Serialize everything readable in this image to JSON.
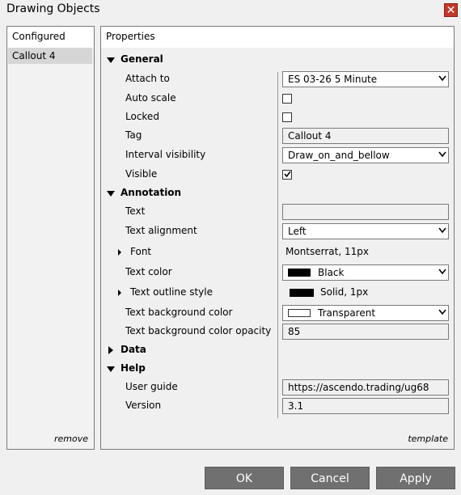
{
  "window": {
    "title": "Drawing Objects",
    "close_label": "✕"
  },
  "left_panel": {
    "header": "Configured",
    "items": [
      {
        "label": "Callout 4"
      }
    ],
    "remove_label": "remove"
  },
  "right_panel": {
    "header": "Properties",
    "template_label": "template",
    "general": {
      "label": "General",
      "attach_to": {
        "label": "Attach to",
        "value": "ES 03-26 5 Minute"
      },
      "auto_scale": {
        "label": "Auto scale",
        "checked": false
      },
      "locked": {
        "label": "Locked",
        "checked": false
      },
      "tag": {
        "label": "Tag",
        "value": "Callout 4"
      },
      "interval_visibility": {
        "label": "Interval visibility",
        "value": "Draw_on_and_bellow"
      },
      "visible": {
        "label": "Visible",
        "checked": true
      }
    },
    "annotation": {
      "label": "Annotation",
      "text": {
        "label": "Text",
        "value": ""
      },
      "text_alignment": {
        "label": "Text alignment",
        "value": "Left"
      },
      "font": {
        "label": "Font",
        "value": "Montserrat, 11px"
      },
      "text_color": {
        "label": "Text color",
        "value": "Black",
        "swatch": "#000000"
      },
      "text_outline_style": {
        "label": "Text outline style",
        "value": "Solid, 1px",
        "swatch": "#000000"
      },
      "text_background_color": {
        "label": "Text background color",
        "value": "Transparent",
        "swatch": "#ffffff"
      },
      "text_background_color_opacity": {
        "label": "Text background color opacity",
        "value": "85"
      }
    },
    "data": {
      "label": "Data"
    },
    "help": {
      "label": "Help",
      "user_guide": {
        "label": "User guide",
        "value": "https://ascendo.trading/ug68"
      },
      "version": {
        "label": "Version",
        "value": "3.1"
      }
    }
  },
  "buttons": {
    "ok": "OK",
    "cancel": "Cancel",
    "apply": "Apply"
  },
  "colors": {
    "button_bg": "#707070",
    "close_bg": "#c0392b"
  }
}
